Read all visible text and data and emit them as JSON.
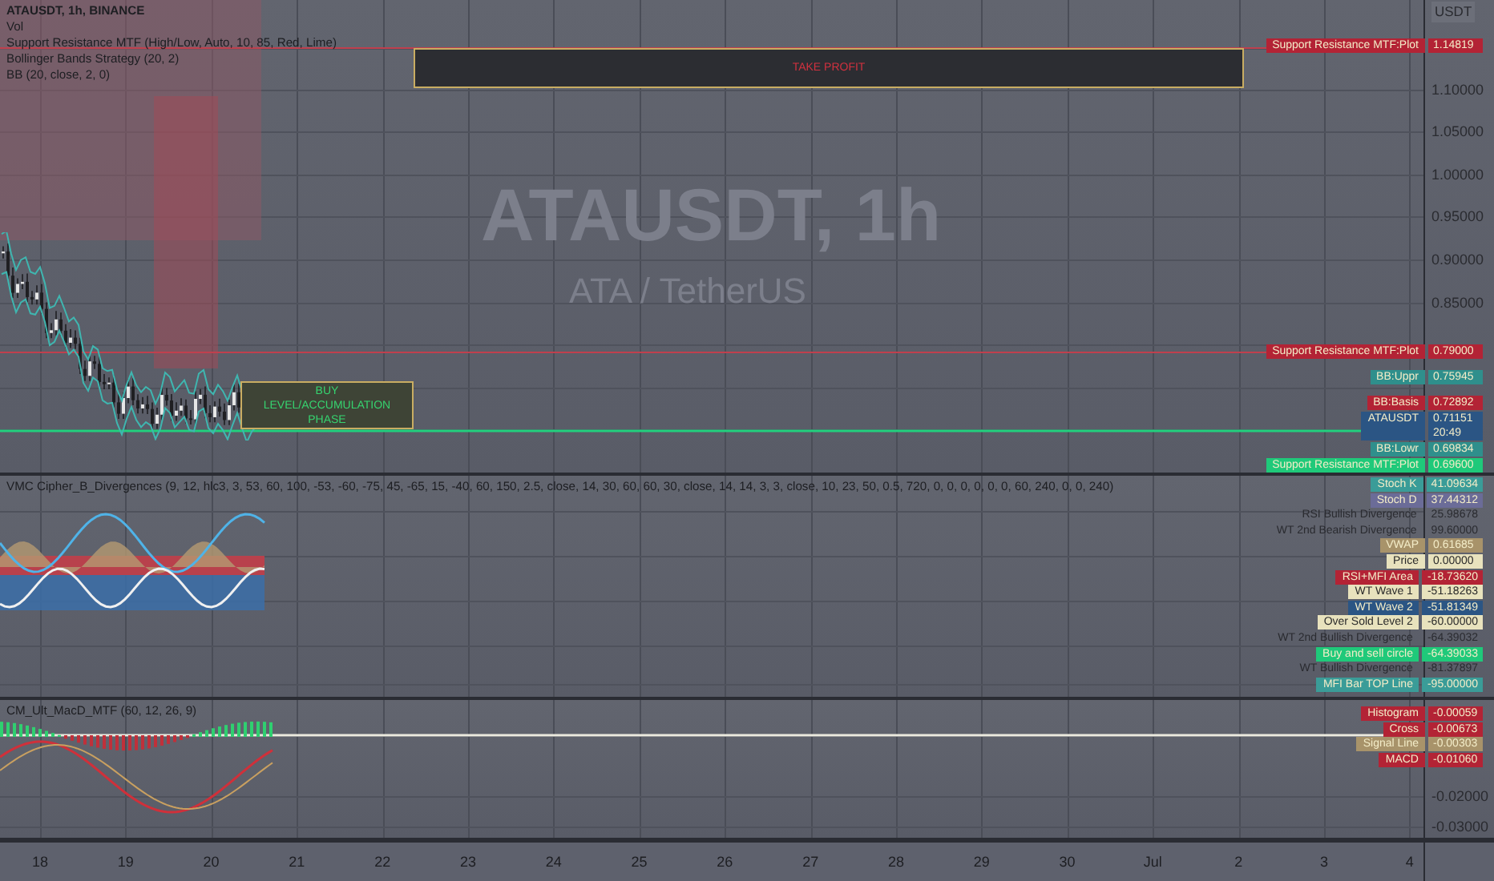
{
  "main_panel": {
    "legend": [
      "ATAUSDT, 1h, BINANCE",
      "Vol",
      "Support Resistance MTF (High/Low, Auto, 10, 85, Red, Lime)",
      "Bollinger Bands Strategy (20, 2)",
      "BB (20, close, 2, 0)"
    ],
    "watermark": {
      "symbol": "ATAUSDT, 1h",
      "description": "ATA / TetherUS"
    },
    "currency": "USDT",
    "ticks": [
      "1.10000",
      "1.05000",
      "1.00000",
      "0.95000",
      "0.90000",
      "0.85000"
    ],
    "boxes": [
      {
        "kind": "target",
        "text": "TAKE PROFIT"
      },
      {
        "kind": "entry",
        "text": "BUY LEVEL/ACCUMULATION PHASE"
      }
    ],
    "labels": [
      {
        "kind": "filled",
        "name": "Support Resistance MTF:Plot",
        "value": "1.14819",
        "color": "#b32335"
      },
      {
        "kind": "filled",
        "name": "Support Resistance MTF:Plot",
        "value": "0.79000",
        "color": "#b32335"
      },
      {
        "kind": "filled",
        "name": "BB:Uppr",
        "value": "0.75945",
        "color": "#2f8f8c"
      },
      {
        "kind": "filled",
        "name": "BB:Basis",
        "value": "0.72892",
        "color": "#b32335"
      },
      {
        "kind": "filled",
        "name": "ATAUSDT",
        "value": "0.71151",
        "sub": "20:49",
        "color": "#2b5584"
      },
      {
        "kind": "filled",
        "name": "BB:Lowr",
        "value": "0.69834",
        "color": "#2f8f8c"
      },
      {
        "kind": "filled",
        "name": "Support Resistance MTF:Plot",
        "value": "0.69600",
        "color": "#1fc97a"
      }
    ]
  },
  "indicator_panel": {
    "legend": "VMC Cipher_B_Divergences (9, 12, hlc3, 3, 53, 60, 100, -53, -60, -75, 45, -65, 15, -40, 60, 150, 2.5, close, 14, 30, 60, 60, 30, close, 14, 14, 3, 3, close, 10, 23, 50, 0.5, 720, 0, 0, 0, 0, 0, 0, 60, 240, 0, 0, 240)",
    "labels": [
      {
        "kind": "filled",
        "name": "Stoch K",
        "value": "41.09634",
        "color": "#3a9c98"
      },
      {
        "kind": "filled",
        "name": "Stoch D",
        "value": "37.44312",
        "color": "#6b6c98"
      },
      {
        "kind": "plain",
        "name": "RSI Bullish Divergence",
        "value": "25.98678"
      },
      {
        "kind": "plain",
        "name": "WT 2nd Bearish Divergence",
        "value": "99.60000"
      },
      {
        "kind": "filled",
        "name": "VWAP",
        "value": "0.61685",
        "color": "#a8936a"
      },
      {
        "kind": "filled",
        "name": "Price",
        "value": "0.00000",
        "color": "#e8e2bd"
      },
      {
        "kind": "filled",
        "name": "RSI+MFI Area",
        "value": "-18.73620",
        "color": "#b32335"
      },
      {
        "kind": "filled",
        "name": "WT Wave 1",
        "value": "-51.18263",
        "color": "#e8e2bd"
      },
      {
        "kind": "filled",
        "name": "WT Wave 2",
        "value": "-51.81349",
        "color": "#2b5584"
      },
      {
        "kind": "filled",
        "name": "Over Sold Level 2",
        "value": "-60.00000",
        "color": "#e8e2bd"
      },
      {
        "kind": "plain",
        "name": "WT 2nd Bullish Divergence",
        "value": "-64.39032"
      },
      {
        "kind": "filled",
        "name": "Buy and sell circle",
        "value": "-64.39033",
        "color": "#1fc97a"
      },
      {
        "kind": "plain",
        "name": "WT Bullish Divergence",
        "value": "-81.37897"
      },
      {
        "kind": "filled",
        "name": "MFI Bar TOP Line",
        "value": "-95.00000",
        "color": "#3a9c98"
      }
    ]
  },
  "macd_panel": {
    "legend": "CM_Ult_MacD_MTF (60, 12, 26, 9)",
    "ticks": [
      "-0.02000",
      "-0.03000"
    ],
    "labels": [
      {
        "kind": "filled",
        "name": "Histogram",
        "value": "-0.00059",
        "color": "#b32335"
      },
      {
        "kind": "filled",
        "name": "Cross",
        "value": "-0.00673",
        "color": "#b32335"
      },
      {
        "kind": "filled",
        "name": "Signal Line",
        "value": "-0.00303",
        "color": "#a8936a"
      },
      {
        "kind": "filled",
        "name": "MACD",
        "value": "-0.01060",
        "color": "#b32335"
      }
    ]
  },
  "time_axis": [
    "18",
    "19",
    "20",
    "21",
    "22",
    "23",
    "24",
    "25",
    "26",
    "27",
    "28",
    "29",
    "30",
    "Jul",
    "2",
    "3",
    "4"
  ]
}
